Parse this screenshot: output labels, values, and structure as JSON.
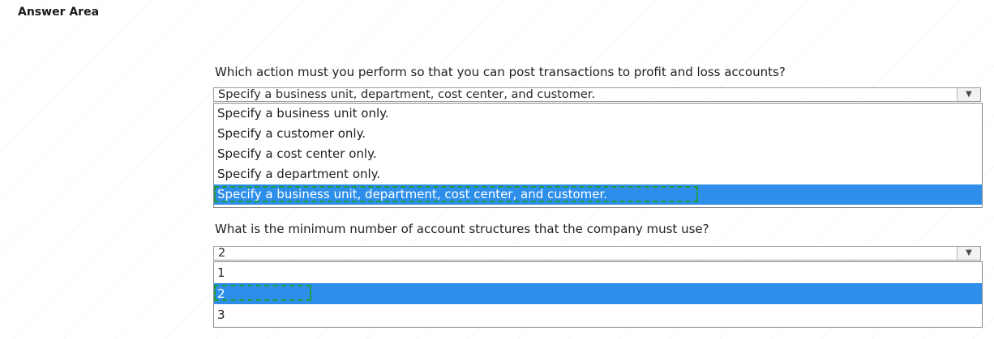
{
  "answer_area_title": "Answer Area",
  "questions": [
    {
      "prompt": "Which action must you perform so that you can post transactions to profit and loss accounts?",
      "selected_value": "Specify a business unit, department, cost center, and customer.",
      "options": [
        "Specify a business unit only.",
        "Specify a customer only.",
        "Specify a cost center only.",
        "Specify a department only.",
        "Specify a business unit, department, cost center, and customer."
      ],
      "highlighted_index": 4
    },
    {
      "prompt": "What is the minimum number of account structures that the company must use?",
      "selected_value": "2",
      "options": [
        "1",
        "2",
        "3"
      ],
      "highlighted_index": 1
    }
  ],
  "icons": {
    "dropdown_arrow": "chevron-down-icon",
    "watermark": "exambrite-watermark"
  },
  "colors": {
    "highlight": "#2e8fea",
    "answer_marker": "#1f9c3a"
  }
}
